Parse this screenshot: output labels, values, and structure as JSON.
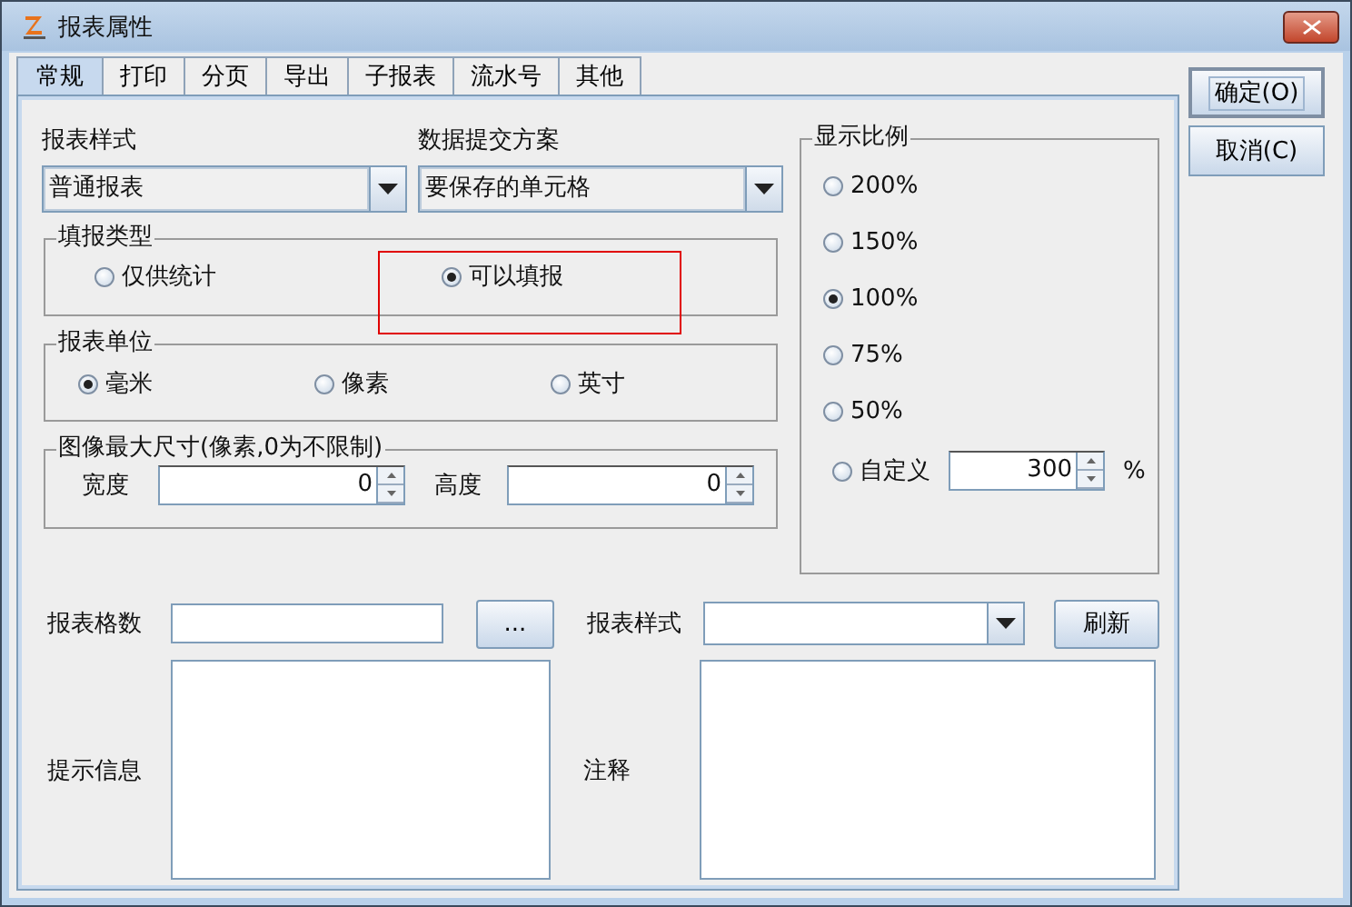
{
  "window": {
    "title": "报表属性"
  },
  "tabs": [
    {
      "label": "常规",
      "selected": true
    },
    {
      "label": "打印",
      "selected": false
    },
    {
      "label": "分页",
      "selected": false
    },
    {
      "label": "导出",
      "selected": false
    },
    {
      "label": "子报表",
      "selected": false
    },
    {
      "label": "流水号",
      "selected": false
    },
    {
      "label": "其他",
      "selected": false
    }
  ],
  "general": {
    "style_label": "报表样式",
    "style_value": "普通报表",
    "submit_label": "数据提交方案",
    "submit_value": "要保存的单元格",
    "fill_type": {
      "title": "填报类型",
      "options": [
        {
          "label": "仅供统计",
          "selected": false
        },
        {
          "label": "可以填报",
          "selected": true
        }
      ]
    },
    "unit": {
      "title": "报表单位",
      "options": [
        {
          "label": "毫米",
          "selected": true
        },
        {
          "label": "像素",
          "selected": false
        },
        {
          "label": "英寸",
          "selected": false
        }
      ]
    },
    "image_size": {
      "title": "图像最大尺寸(像素,0为不限制)",
      "width_label": "宽度",
      "width_value": "0",
      "height_label": "高度",
      "height_value": "0"
    },
    "zoom": {
      "title": "显示比例",
      "options": [
        {
          "label": "200%",
          "selected": false
        },
        {
          "label": "150%",
          "selected": false
        },
        {
          "label": "100%",
          "selected": true
        },
        {
          "label": "75%",
          "selected": false
        },
        {
          "label": "50%",
          "selected": false
        }
      ],
      "custom": {
        "label": "自定义",
        "selected": false,
        "value": "300",
        "unit": "%"
      }
    },
    "grid_count_label": "报表格数",
    "browse_button": "...",
    "bottom_style_label": "报表样式",
    "refresh_button": "刷新",
    "hint_label": "提示信息",
    "note_label": "注释"
  },
  "buttons": [
    {
      "label": "确定(O)",
      "default": true
    },
    {
      "label": "取消(C)",
      "default": false
    }
  ]
}
